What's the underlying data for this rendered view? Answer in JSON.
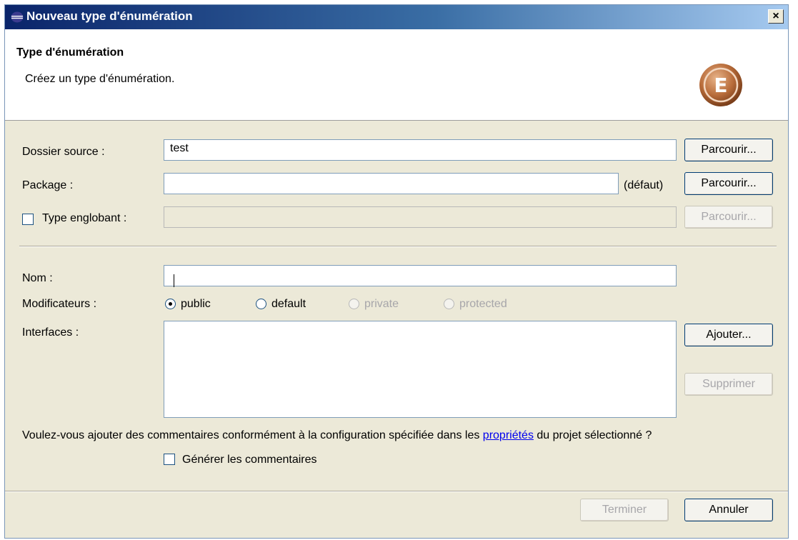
{
  "window": {
    "title": "Nouveau type d'énumération",
    "close_label": "×"
  },
  "banner": {
    "heading": "Type d'énumération",
    "description": "Créez un type d'énumération.",
    "logo_letter": "E"
  },
  "form": {
    "source_folder": {
      "label": "Dossier source :",
      "value": "test",
      "browse_label": "Parcourir..."
    },
    "package": {
      "label": "Package :",
      "value": "",
      "default_label": "(défaut)",
      "browse_label": "Parcourir..."
    },
    "enclosing_type": {
      "label": "Type englobant :",
      "checked": false,
      "value": "",
      "browse_label": "Parcourir..."
    },
    "name": {
      "label": "Nom :",
      "value": ""
    },
    "modifiers": {
      "label": "Modificateurs :",
      "options": [
        {
          "label": "public",
          "selected": true,
          "enabled": true
        },
        {
          "label": "default",
          "selected": false,
          "enabled": true
        },
        {
          "label": "private",
          "selected": false,
          "enabled": false
        },
        {
          "label": "protected",
          "selected": false,
          "enabled": false
        }
      ]
    },
    "interfaces": {
      "label": "Interfaces :",
      "add_label": "Ajouter...",
      "remove_label": "Supprimer"
    },
    "comments": {
      "question_before": "Voulez-vous ajouter des commentaires conformément à la configuration spécifiée dans les ",
      "link_text": "propriétés",
      "question_after": " du projet sélectionné ?",
      "generate_label": "Générer les commentaires",
      "checked": false
    }
  },
  "footer": {
    "finish_label": "Terminer",
    "cancel_label": "Annuler"
  }
}
